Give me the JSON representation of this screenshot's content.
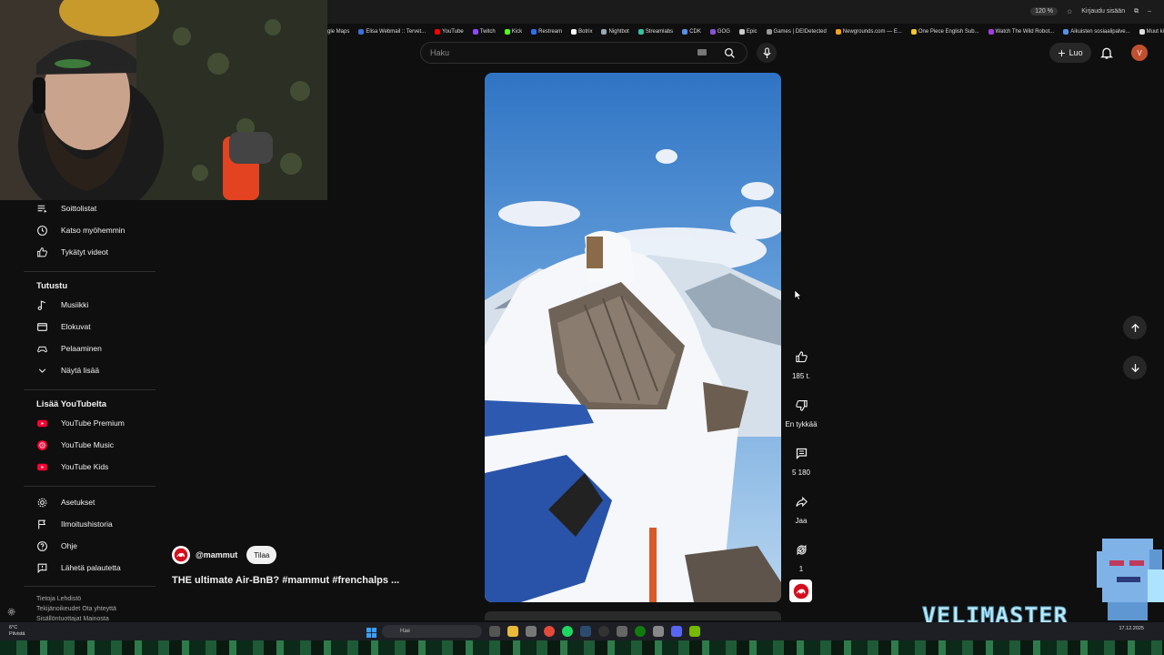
{
  "browser": {
    "zoom": "120 %",
    "signin": "Kirjaudu sisään",
    "bookmarks": [
      {
        "label": "gle Maps",
        "color": ""
      },
      {
        "label": "Elisa Webmail :: Tervet...",
        "color": "#3a6fd8"
      },
      {
        "label": "YouTube",
        "color": "#ff0000"
      },
      {
        "label": "Twitch",
        "color": "#9146ff"
      },
      {
        "label": "Kick",
        "color": "#53fc18"
      },
      {
        "label": "Restream",
        "color": "#2f6ff5"
      },
      {
        "label": "Botrix",
        "color": "#ffffff"
      },
      {
        "label": "Nightbot",
        "color": "#9aa7b8"
      },
      {
        "label": "Streamlabs",
        "color": "#31c3a2"
      },
      {
        "label": "CDK",
        "color": "#5b8ee6"
      },
      {
        "label": "GOG",
        "color": "#8a4fd8"
      },
      {
        "label": "Epic",
        "color": "#cccccc"
      },
      {
        "label": "Games | DEIDetected",
        "color": "#999999"
      },
      {
        "label": "Newgrounds.com — E...",
        "color": "#f7a21b"
      },
      {
        "label": "One Piece English Sub...",
        "color": "#f4c430"
      },
      {
        "label": "Watch The Wild Robot...",
        "color": "#a33ce0"
      },
      {
        "label": "Aikuisten sosiaalipalve...",
        "color": "#5590e6"
      },
      {
        "label": "Muut kirjanmerkit",
        "color": "#dddddd"
      }
    ]
  },
  "header": {
    "search_placeholder": "Haku",
    "create_label": "Luo",
    "avatar_letter": "V"
  },
  "sidebar": {
    "you_items": [
      {
        "label": "Soittolistat",
        "icon": "playlist-icon"
      },
      {
        "label": "Katso myöhemmin",
        "icon": "clock-icon"
      },
      {
        "label": "Tykätyt videot",
        "icon": "thumbs-up-icon"
      }
    ],
    "explore_heading": "Tutustu",
    "explore_items": [
      {
        "label": "Musiikki",
        "icon": "music-icon"
      },
      {
        "label": "Elokuvat",
        "icon": "film-icon"
      },
      {
        "label": "Pelaaminen",
        "icon": "gamepad-icon"
      },
      {
        "label": "Näytä lisää",
        "icon": "chevron-down-icon"
      }
    ],
    "more_heading": "Lisää YouTubelta",
    "more_items": [
      {
        "label": "YouTube Premium",
        "icon": "youtube-premium-icon"
      },
      {
        "label": "YouTube Music",
        "icon": "youtube-music-icon"
      },
      {
        "label": "YouTube Kids",
        "icon": "youtube-kids-icon"
      }
    ],
    "settings_items": [
      {
        "label": "Asetukset",
        "icon": "gear-icon"
      },
      {
        "label": "Ilmoitushistoria",
        "icon": "flag-icon"
      },
      {
        "label": "Ohje",
        "icon": "help-icon"
      },
      {
        "label": "Lähetä palautetta",
        "icon": "feedback-icon"
      }
    ],
    "footer_line1": "Tietoja  Lehdistö",
    "footer_line2": "Tekijänoikeudet  Ota yhteyttä",
    "footer_line3": "Sisällöntuottajat  Mainosta"
  },
  "short": {
    "channel": "@mammut",
    "subscribe_label": "Tilaa",
    "title": "THE ultimate Air-BnB? #mammut #frenchalps ...",
    "likes": "185 t.",
    "dislike_label": "En tykkää",
    "comments": "5 180",
    "share_label": "Jaa",
    "remix_count": "1"
  },
  "taskbar": {
    "weather_temp": "6°C",
    "weather_desc": "Pilvistä",
    "search_placeholder": "Hae",
    "date": "17.12.2025"
  },
  "overlay": {
    "brand_text": "VELIMASTER"
  }
}
